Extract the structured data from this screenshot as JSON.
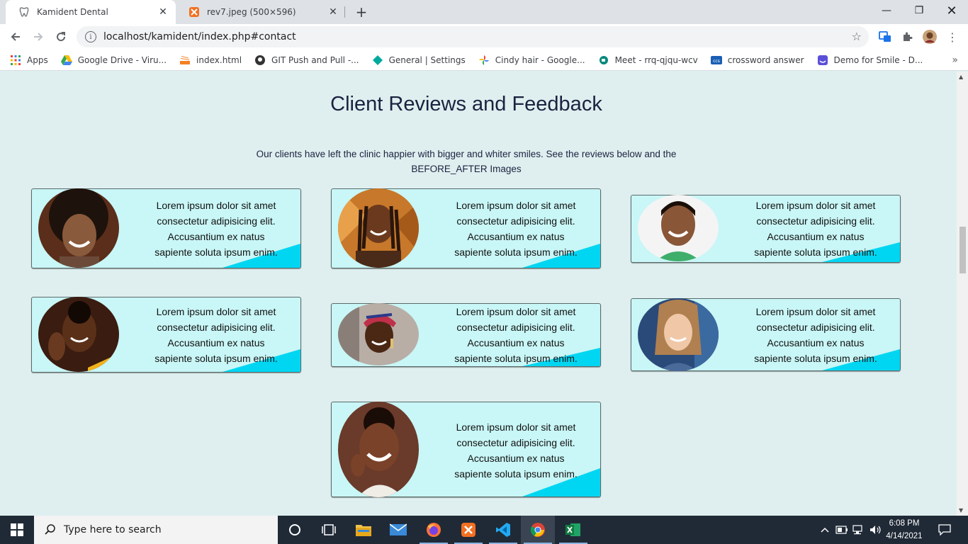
{
  "browser": {
    "tabs": [
      {
        "title": "Kamident Dental",
        "active": true
      },
      {
        "title": "rev7.jpeg (500×596)",
        "active": false
      }
    ],
    "url": "localhost/kamident/index.php#contact",
    "bookmarks": [
      {
        "label": "Apps",
        "icon": "apps-grid-icon"
      },
      {
        "label": "Google Drive - Viru...",
        "icon": "google-drive-icon"
      },
      {
        "label": "index.html",
        "icon": "stack-icon"
      },
      {
        "label": "GIT Push and Pull -...",
        "icon": "github-icon"
      },
      {
        "label": "General | Settings",
        "icon": "diamond-icon"
      },
      {
        "label": "Cindy hair - Google...",
        "icon": "google-photos-icon"
      },
      {
        "label": "Meet - rrq-qjqu-wcv",
        "icon": "meet-icon"
      },
      {
        "label": "crossword answer",
        "icon": "ccs-icon"
      },
      {
        "label": "Demo for Smile - D...",
        "icon": "smile-icon"
      }
    ]
  },
  "section": {
    "title": "Client Reviews and Feedback",
    "subtitle_line1": "Our clients have left the clinic happier with bigger and whiter smiles. See the reviews below and the",
    "subtitle_line2": "BEFORE_AFTER Images"
  },
  "reviews": [
    {
      "line1": "Lorem ipsum dolor sit amet",
      "line2": "consectetur adipisicing elit.",
      "line3": "Accusantium ex natus",
      "line4": "sapiente soluta ipsum enim."
    },
    {
      "line1": "Lorem ipsum dolor sit amet",
      "line2": "consectetur adipisicing elit.",
      "line3": "Accusantium ex natus",
      "line4": "sapiente soluta ipsum enim."
    },
    {
      "line1": "Lorem ipsum dolor sit amet",
      "line2": "consectetur adipisicing elit.",
      "line3": "Accusantium ex natus",
      "line4": "sapiente soluta ipsum enim."
    },
    {
      "line1": "Lorem ipsum dolor sit amet",
      "line2": "consectetur adipisicing elit.",
      "line3": "Accusantium ex natus",
      "line4": "sapiente soluta ipsum enim."
    },
    {
      "line1": "Lorem ipsum dolor sit amet",
      "line2": "consectetur adipisicing elit.",
      "line3": "Accusantium ex natus",
      "line4": "sapiente soluta ipsum enim."
    },
    {
      "line1": "Lorem ipsum dolor sit amet",
      "line2": "consectetur adipisicing elit.",
      "line3": "Accusantium ex natus",
      "line4": "sapiente soluta ipsum enim."
    },
    {
      "line1": "Lorem ipsum dolor sit amet",
      "line2": "consectetur adipisicing elit.",
      "line3": "Accusantium ex natus",
      "line4": "sapiente soluta ipsum enim."
    }
  ],
  "taskbar": {
    "search_placeholder": "Type here to search",
    "time": "6:08 PM",
    "date": "4/14/2021"
  },
  "colors": {
    "page_bg": "#dfefef",
    "card_bg": "#c9f6f6",
    "accent": "#00d6f2",
    "heading": "#1b2240"
  }
}
